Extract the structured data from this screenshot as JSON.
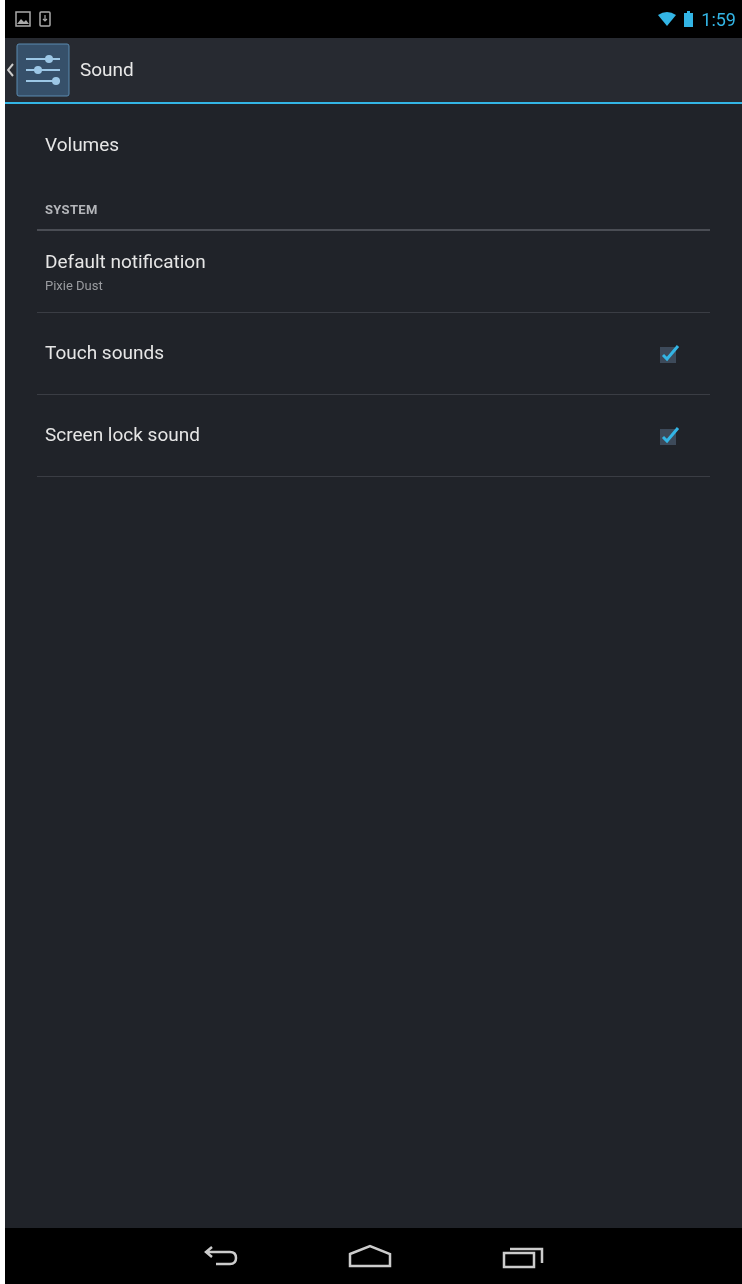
{
  "status_bar": {
    "time": "1:59"
  },
  "action_bar": {
    "title": "Sound"
  },
  "items": [
    {
      "kind": "item",
      "title": "Volumes"
    },
    {
      "kind": "header",
      "title": "SYSTEM"
    },
    {
      "kind": "item",
      "title": "Default notification",
      "summary": "Pixie Dust"
    },
    {
      "kind": "checkbox",
      "title": "Touch sounds",
      "checked": true
    },
    {
      "kind": "checkbox",
      "title": "Screen lock sound",
      "checked": true
    }
  ]
}
